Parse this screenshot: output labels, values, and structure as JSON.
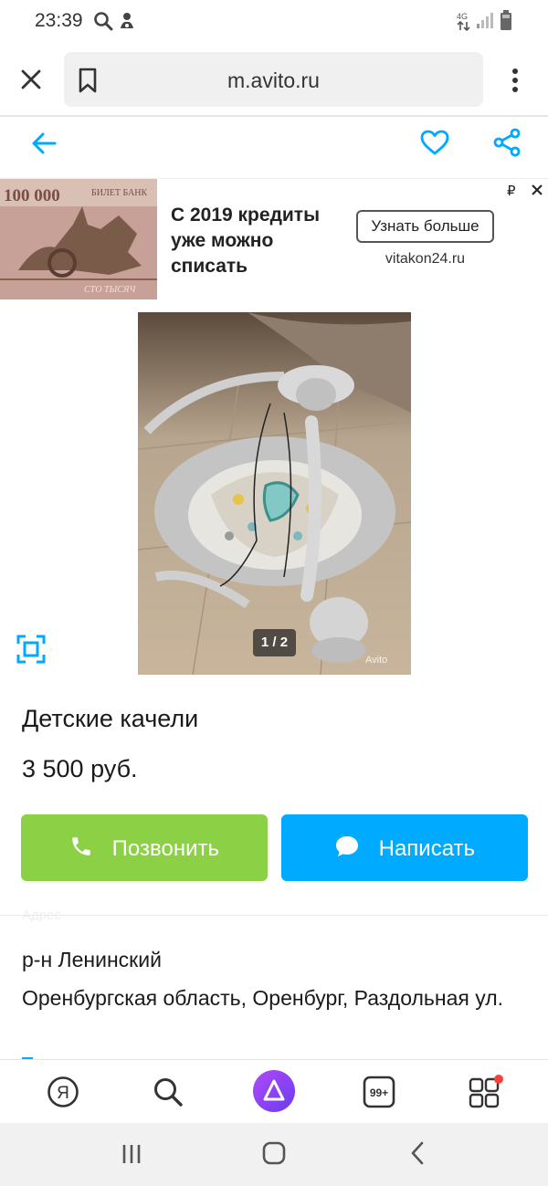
{
  "status_bar": {
    "time": "23:39",
    "network": "4G",
    "icons": [
      "search-icon",
      "notification-icon",
      "data-arrows-icon",
      "signal-icon",
      "battery-icon"
    ]
  },
  "browser": {
    "url": "m.avito.ru",
    "icons": [
      "close-icon",
      "bookmark-icon",
      "more-vert-icon"
    ]
  },
  "site_header": {
    "icons": [
      "back-arrow-icon",
      "heart-icon",
      "share-icon"
    ],
    "accent": "#00aaff"
  },
  "ad": {
    "headline": "С 2019 кредиты уже можно списать",
    "cta_label": "Узнать больше",
    "domain": "vitakon24.ru",
    "currency_mark": "₽",
    "banknote_text_top": "100 000",
    "banknote_text_bank": "БИЛЕТ БАНК",
    "banknote_text_bottom": "СТО ТЫСЯЧ"
  },
  "gallery": {
    "counter": "1 / 2",
    "watermark": "Avito",
    "current": 1,
    "total": 2
  },
  "listing": {
    "title": "Детские качели",
    "price": "3 500 руб.",
    "call_label": "Позвонить",
    "write_label": "Написать",
    "faded_label": "Адрес",
    "district": "р-н Ленинский",
    "address": "Оренбургская область, Оренбург, Раздольная ул."
  },
  "colors": {
    "call_button": "#8cd045",
    "write_button": "#00aaff",
    "alice_purple": "#8a3ff6",
    "notification_dot": "#f44336"
  },
  "bottom_toolbar": {
    "yandex_label": "Я",
    "tabs_count": "99+",
    "icons": [
      "yandex-icon",
      "search-icon",
      "alice-icon",
      "tabs-icon",
      "apps-icon"
    ]
  },
  "system_nav": {
    "icons": [
      "recents-icon",
      "home-icon",
      "back-icon"
    ]
  }
}
